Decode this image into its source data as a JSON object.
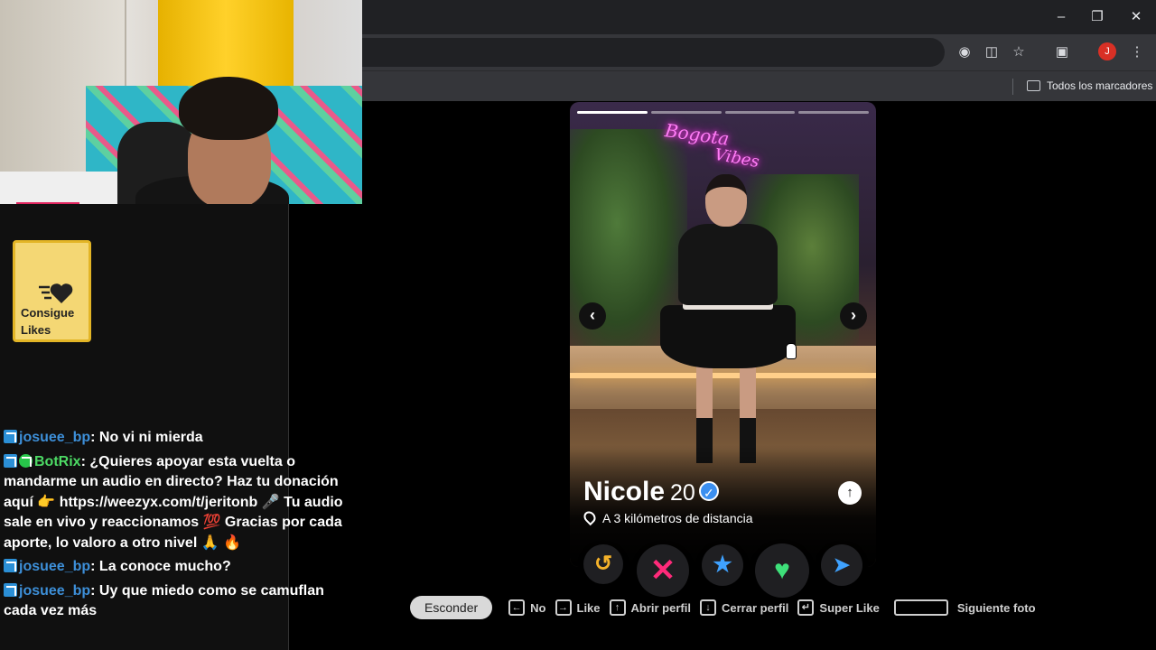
{
  "stream": {
    "promo_card": {
      "label_line1": "Consigue",
      "label_line2": "Likes"
    },
    "chat": [
      {
        "user": "josuee_bp",
        "text": "No vi ni mierda"
      },
      {
        "user": "BotRix",
        "text": "¿Quieres apoyar esta vuelta o mandarme un audio en directo? Haz tu donación aquí 👉 https://weezyx.com/t/jeritonb 🎤 Tu audio sale en vivo y reaccionamos 💯 Gracias por cada aporte, lo valoro a otro nivel 🙏 🔥"
      },
      {
        "user": "josuee_bp",
        "text": "La conoce mucho?"
      },
      {
        "user": "josuee_bp",
        "text": "Uy que miedo como se camuflan cada vez más"
      }
    ]
  },
  "browser": {
    "window_controls": {
      "minimize": "–",
      "restore": "❐",
      "close": "✕"
    },
    "toolbar_icons": [
      "location-icon",
      "cast-icon",
      "star-icon",
      "extensions-icon",
      "menu-icon"
    ],
    "profile_initial": "J",
    "bookmarks_label": "Todos los marcadores"
  },
  "profile": {
    "neon_line1": "Bogota",
    "neon_line2": "Vibes",
    "name": "Nicole",
    "age": "20",
    "distance": "A 3 kilómetros de distancia",
    "photo_count": 4,
    "current_photo": 1
  },
  "actions": {
    "rewind": "↺",
    "nope": "✕",
    "super_like": "★",
    "like": "♥",
    "boost": "➤"
  },
  "hints": {
    "hide": "Esconder",
    "no": "No",
    "like": "Like",
    "open_profile": "Abrir perfil",
    "close_profile": "Cerrar perfil",
    "super_like": "Super Like",
    "next_photo": "Siguiente foto"
  },
  "colors": {
    "accent_pink": "#ff2a7a",
    "accent_green": "#3ee07a",
    "accent_blue": "#3fa2ff",
    "accent_gold": "#f5b22a",
    "chat_user": "#3d8fd8",
    "bot_user": "#4cd964"
  }
}
